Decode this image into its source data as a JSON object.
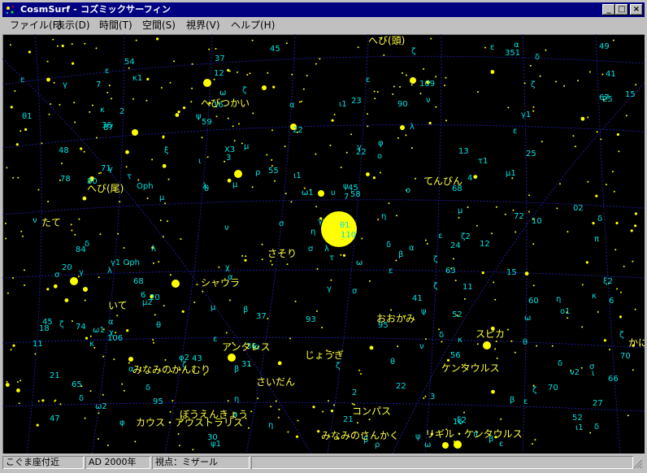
{
  "window": {
    "title": "CosmSurf - コズミックサーフィン"
  },
  "menu": [
    {
      "label": "ファイル(F)"
    },
    {
      "label": "表示(D)"
    },
    {
      "label": "時間(T)"
    },
    {
      "label": "空間(S)"
    },
    {
      "label": "視界(V)"
    },
    {
      "label": "ヘルプ(H)"
    }
  ],
  "title_buttons": {
    "minimize": "_",
    "maximize": "□",
    "close": "×"
  },
  "sky": {
    "background": "#000000",
    "grid_color": "#1c1c9a",
    "star_color": "#ffff00",
    "label_color": "#00e0e0",
    "constellation_color": "#ffff40",
    "constellations": [
      "へび(頭)",
      "へびつかい",
      "てんびん",
      "へび(尾)",
      "たて",
      "さそり",
      "いて",
      "シャウラ",
      "おおかみ",
      "アンタレス",
      "じょうぎ",
      "みなみのかんむり",
      "ケンタウルス",
      "さいだん",
      "ぼうえんきょう",
      "コンパス",
      "カウス・アウストラリス",
      "みなみのさんかく",
      "リギル・ケンタウルス",
      "スピカ",
      "かに"
    ],
    "star_labels": [
      "95",
      "70",
      "37",
      "θ",
      "ρ",
      "χ",
      "τ1",
      "22",
      "20",
      "6",
      "02",
      "93",
      "2",
      "59",
      "ε",
      "β",
      "43",
      "δ",
      "25",
      "υ",
      "18",
      "15",
      "ρ",
      "ζ",
      "κ",
      "ν",
      "τ",
      "66",
      "67",
      "16",
      "6",
      "31",
      "25",
      "54",
      "σ",
      "κ",
      "γ",
      "μ1",
      "45",
      "μ",
      "λ",
      "9",
      "β",
      "δ",
      "36",
      "48",
      "ξ2",
      "106",
      "ε",
      "41",
      "γ",
      "ξ",
      "χ",
      "ψ",
      "ω1",
      "η",
      "41",
      "11",
      "84",
      "95",
      "60",
      "σ",
      "μ",
      "30",
      "22",
      "16",
      "13",
      "σ",
      "47",
      "ν",
      "68",
      "ε",
      "20",
      "ω",
      "o",
      "θ1",
      "2",
      "87",
      "15",
      "Oph",
      "23",
      "φ",
      "ψ",
      "27",
      "β",
      "γ",
      "78",
      "η",
      "λ",
      "52",
      "τ",
      "71",
      "80",
      "24",
      "γ1",
      "π",
      "10",
      "φ2",
      "63",
      "ν",
      "65",
      "36",
      "4",
      "74",
      "μ2",
      "ι",
      "ζ",
      "μ",
      "58",
      "68",
      "δ",
      "ω",
      "π",
      "σ",
      "7",
      "37",
      "κ",
      "δ",
      "λ",
      "90",
      "α",
      "ε",
      "κ",
      "ζ",
      "δ",
      "ω2",
      "3",
      "109",
      "κ1",
      "ζ2",
      "α",
      "55",
      "ε",
      "δ",
      "21",
      "μ",
      "X3",
      "11",
      "λ",
      "ν",
      "ι1",
      "η",
      "ζ",
      "ε",
      "ψ",
      "ι1",
      "52",
      "12",
      "22",
      "δ",
      "η",
      "α",
      "ζ",
      "ι",
      "α",
      "ψ",
      "μ",
      "70",
      "ω",
      "49",
      "α",
      "β",
      "ζ",
      "γ",
      "σ",
      "β",
      "ε",
      "δ",
      "21",
      "7",
      "γ",
      "θ",
      "ι1",
      "3",
      "ξ2",
      "45",
      "12",
      "α",
      "ν2",
      "ε",
      "θ1",
      "ζ",
      "φ",
      "ε",
      "ο",
      "β",
      "θ",
      "56",
      "θ",
      "ζ",
      "η",
      "ζ",
      "ψ1",
      "ε",
      "δ",
      "λ",
      "72",
      "γ",
      "351",
      "α",
      "o1",
      "45",
      "ω",
      "ζ"
    ],
    "named_labels": [
      "110",
      "γ1 Oph",
      "ω1"
    ]
  },
  "status": {
    "region": "こぐま座付近",
    "epoch": "AD 2000年",
    "viewpoint": "視点：ミザール"
  }
}
